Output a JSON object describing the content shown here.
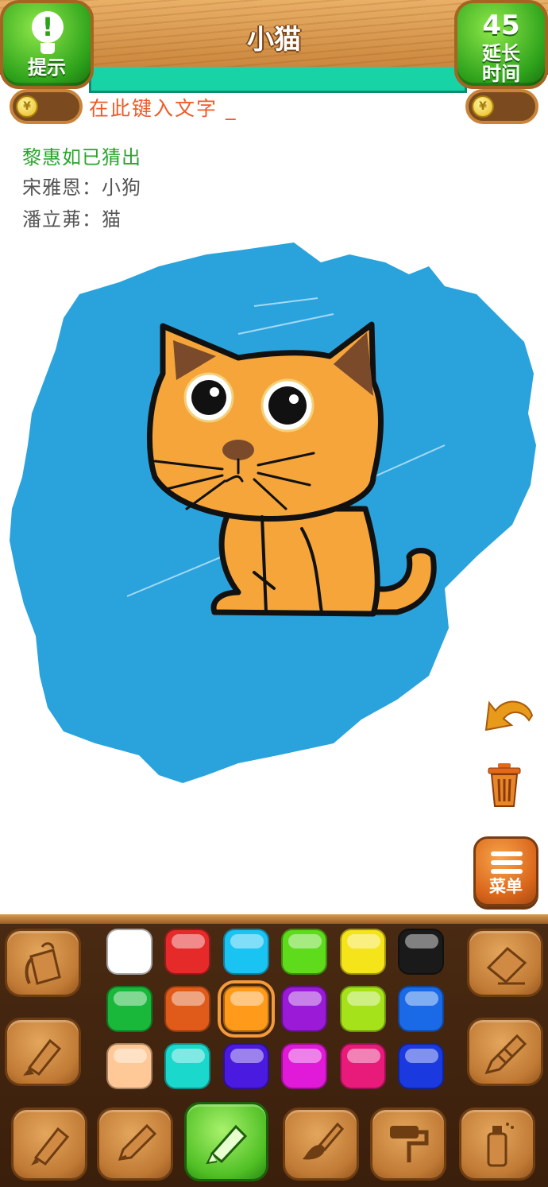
{
  "header": {
    "title": "小猫",
    "hint_label": "提示",
    "hint_icon": "lightbulb-exclamation-icon",
    "time_seconds": "45",
    "time_label_line1": "延长",
    "time_label_line2": "时间",
    "coin_symbol": "¥",
    "input_placeholder": "在此键入文字 _"
  },
  "chat": [
    {
      "text": "黎惠如已猜出",
      "type": "correct"
    },
    {
      "text": "宋雅恩：小狗",
      "type": "guess"
    },
    {
      "text": "潘立茀：猫",
      "type": "guess"
    }
  ],
  "side_tools": {
    "undo_icon": "undo-arrow-icon",
    "trash_icon": "trash-can-icon",
    "menu_label": "菜单"
  },
  "palette": {
    "selected": "#ff9a1a",
    "colors": [
      [
        "#ffffff",
        "#e62a2a",
        "#1ac4f2",
        "#5edb1a",
        "#f5e41a",
        "#1a1a1a"
      ],
      [
        "#19b83a",
        "#e05a1a",
        "#ff9a1a",
        "#9a1ad8",
        "#a6e21a",
        "#1a6ae8"
      ],
      [
        "#ffc896",
        "#1ad8cc",
        "#4a1ae0",
        "#e01ad8",
        "#e81a7a",
        "#1a3ae0"
      ]
    ]
  },
  "tools": {
    "left": [
      "paint-bucket-icon",
      "marker-icon"
    ],
    "right": [
      "eraser-icon",
      "crayon-icon"
    ],
    "bottom": [
      "fountain-pen-icon",
      "pencil-icon",
      "highlighter-icon",
      "paintbrush-icon",
      "roller-icon",
      "spray-can-icon"
    ],
    "active": "highlighter-icon"
  },
  "colors": {
    "canvas_background_stroke": "#2aa3dd",
    "cat_body": "#f5a53a",
    "timer_bar": "#18d3a6",
    "input_text": "#f05a28",
    "correct_text": "#2aa52a"
  }
}
